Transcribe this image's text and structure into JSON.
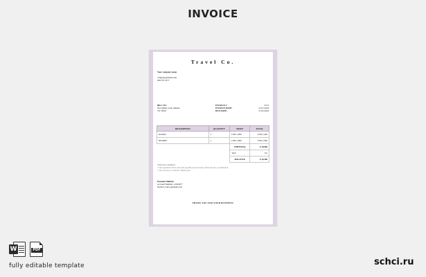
{
  "header": {
    "title": "INVOICE"
  },
  "document": {
    "company": "Travel Co.",
    "from": {
      "label": "Your company name",
      "email": "company@email.com",
      "phone": "000 555 5277"
    },
    "bill_to": {
      "label": "BILL TO:",
      "address_1": "504 Johnny Lane Abilene",
      "address_2": "TX 79601"
    },
    "meta": {
      "invoice_label": "INVOICE #",
      "invoice_value": "4713",
      "invoice_date_label": "INVOICE DATE:",
      "invoice_date_value": "01.01.2024",
      "due_date_label": "DUE DATE:",
      "due_date_value": "01.05.2024"
    },
    "table": {
      "headers": [
        "DESCRIPTION",
        "QUANTITY",
        "PRICE",
        "TOTAL"
      ],
      "rows": [
        [
          "KAYAK",
          "1",
          "USD 1,000",
          "USD 1,000"
        ],
        [
          "RESORT",
          "1",
          "USD 1,000",
          "USD 1,000"
        ]
      ],
      "subtotal_label": "SUBTOTAL",
      "subtotal_value": "$ 10,000",
      "tax_label": "TAX",
      "tax_value": "3%",
      "balance_label": "BALANCE",
      "balance_value": "$ 10,300"
    },
    "terms": {
      "label": "Terms & Conditions",
      "line_1": "• The payment will be due and payable upon receipt of this invoice, as indicated.",
      "line_2": "• The services as ordered. Thank you."
    },
    "payment": {
      "label": "Payment Method",
      "account": "Account Number: 12345677",
      "paypal": "PayPal: yourco@email.com"
    },
    "thanks": "THANK YOU FOR YOUR BUSINESS!"
  },
  "footer": {
    "word_icon_letter": "W",
    "pdf_icon_text": "PDF",
    "editable_text": "fully editable template",
    "brand": "schci.ru"
  }
}
